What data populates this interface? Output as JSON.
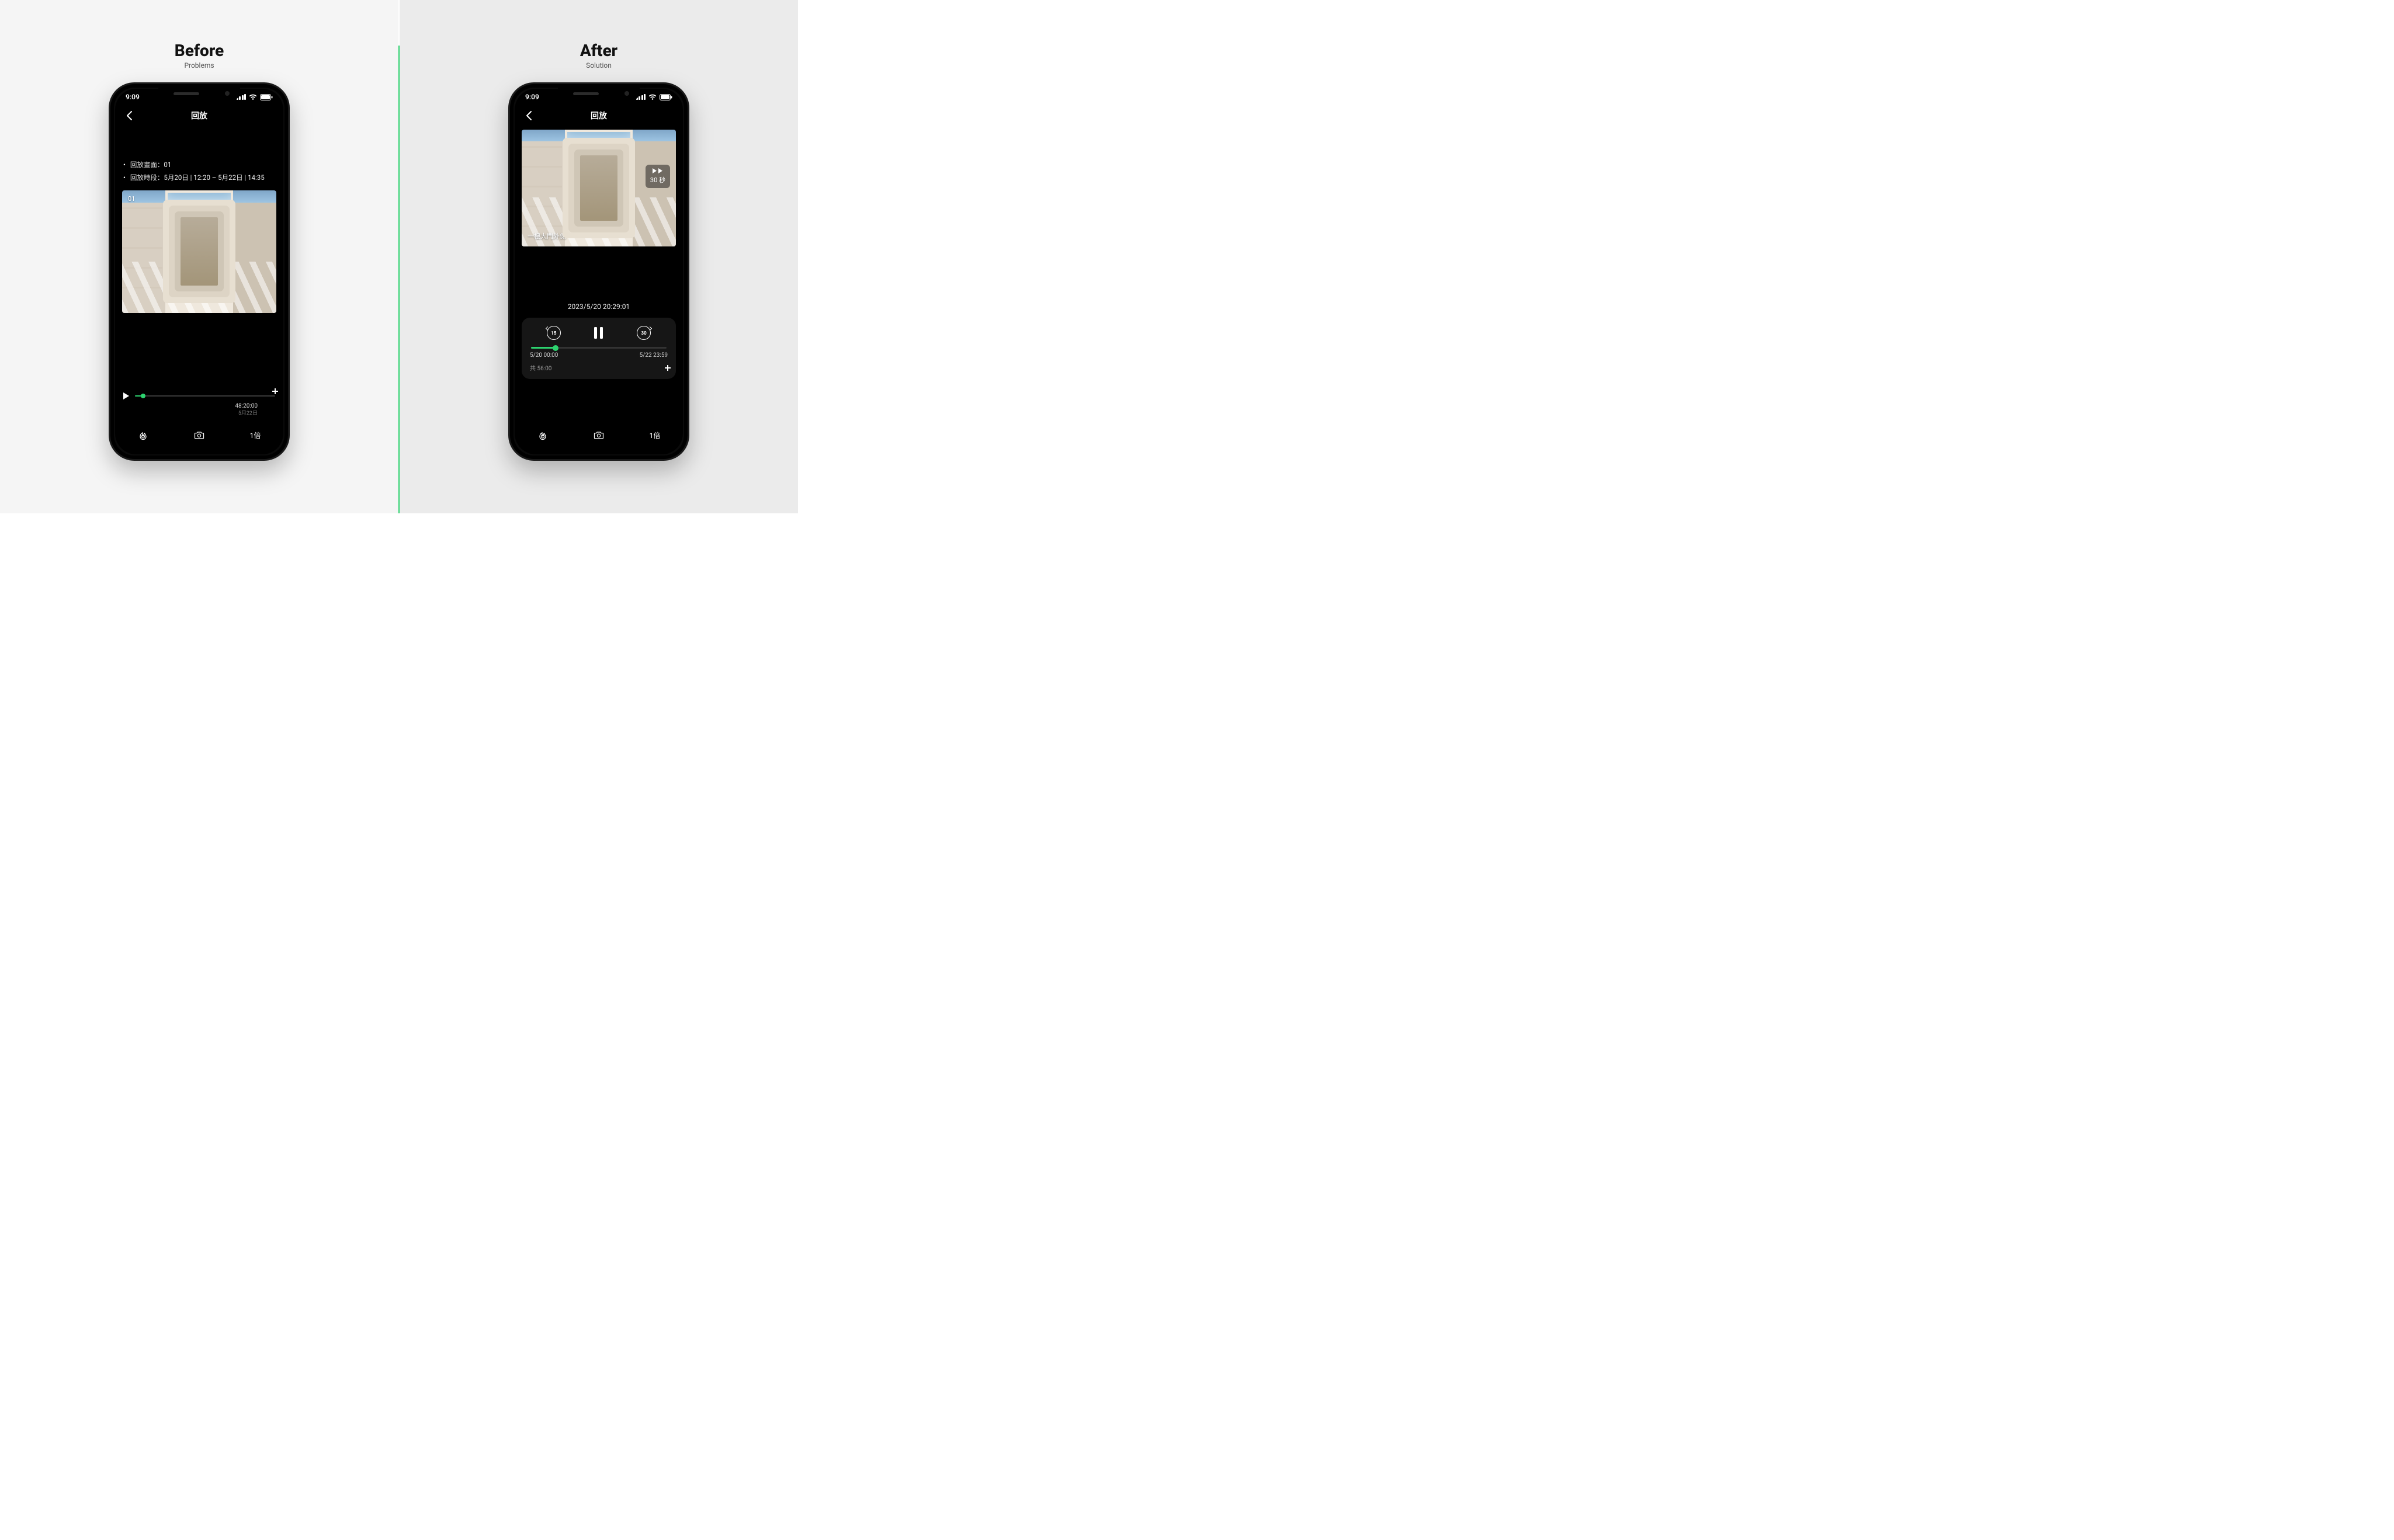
{
  "left": {
    "heading": "Before",
    "subheading": "Problems",
    "status_time": "9:09",
    "app_title": "回放",
    "meta_line1": "回放畫面：01",
    "meta_line2": "回放時段：5月20日 | 12:20 – 5月22日 | 14:35",
    "video_label": "01",
    "timecode": "48:20:00",
    "timedate": "5月22日",
    "speed_label": "1倍"
  },
  "right": {
    "heading": "After",
    "subheading": "Solution",
    "status_time": "9:09",
    "app_title": "回放",
    "camera_name": "一樓大門外側",
    "skip_label": "30 秒",
    "current_timestamp": "2023/5/20  20:29:01",
    "rewind_value": "15",
    "forward_value": "30",
    "track_start": "5/20 00:00",
    "track_end": "5/22 23:59",
    "total_label": "共 56:00",
    "speed_label": "1倍"
  },
  "icons": {
    "burn": "burn-icon",
    "camera": "camera-icon",
    "fullscreen": "fullscreen-icon"
  }
}
